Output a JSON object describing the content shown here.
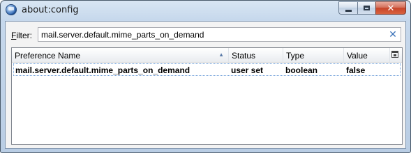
{
  "window": {
    "title": "about:config"
  },
  "filter": {
    "label_prefix": "",
    "label_access_key": "F",
    "label_rest": "ilter:",
    "value": "mail.server.default.mime_parts_on_demand",
    "clear_symbol": "✕"
  },
  "columns": [
    {
      "label": "Preference Name",
      "sorted": "ascending"
    },
    {
      "label": "Status"
    },
    {
      "label": "Type"
    },
    {
      "label": "Value"
    }
  ],
  "rows": [
    {
      "name": "mail.server.default.mime_parts_on_demand",
      "status": "user set",
      "type": "boolean",
      "value": "false"
    }
  ],
  "icons": {
    "app": "thunderbird-icon",
    "minimize": "minimize-icon",
    "maximize": "maximize-icon",
    "close": "close-icon",
    "sort": "sort-ascending-icon",
    "column_picker": "column-picker-icon"
  }
}
